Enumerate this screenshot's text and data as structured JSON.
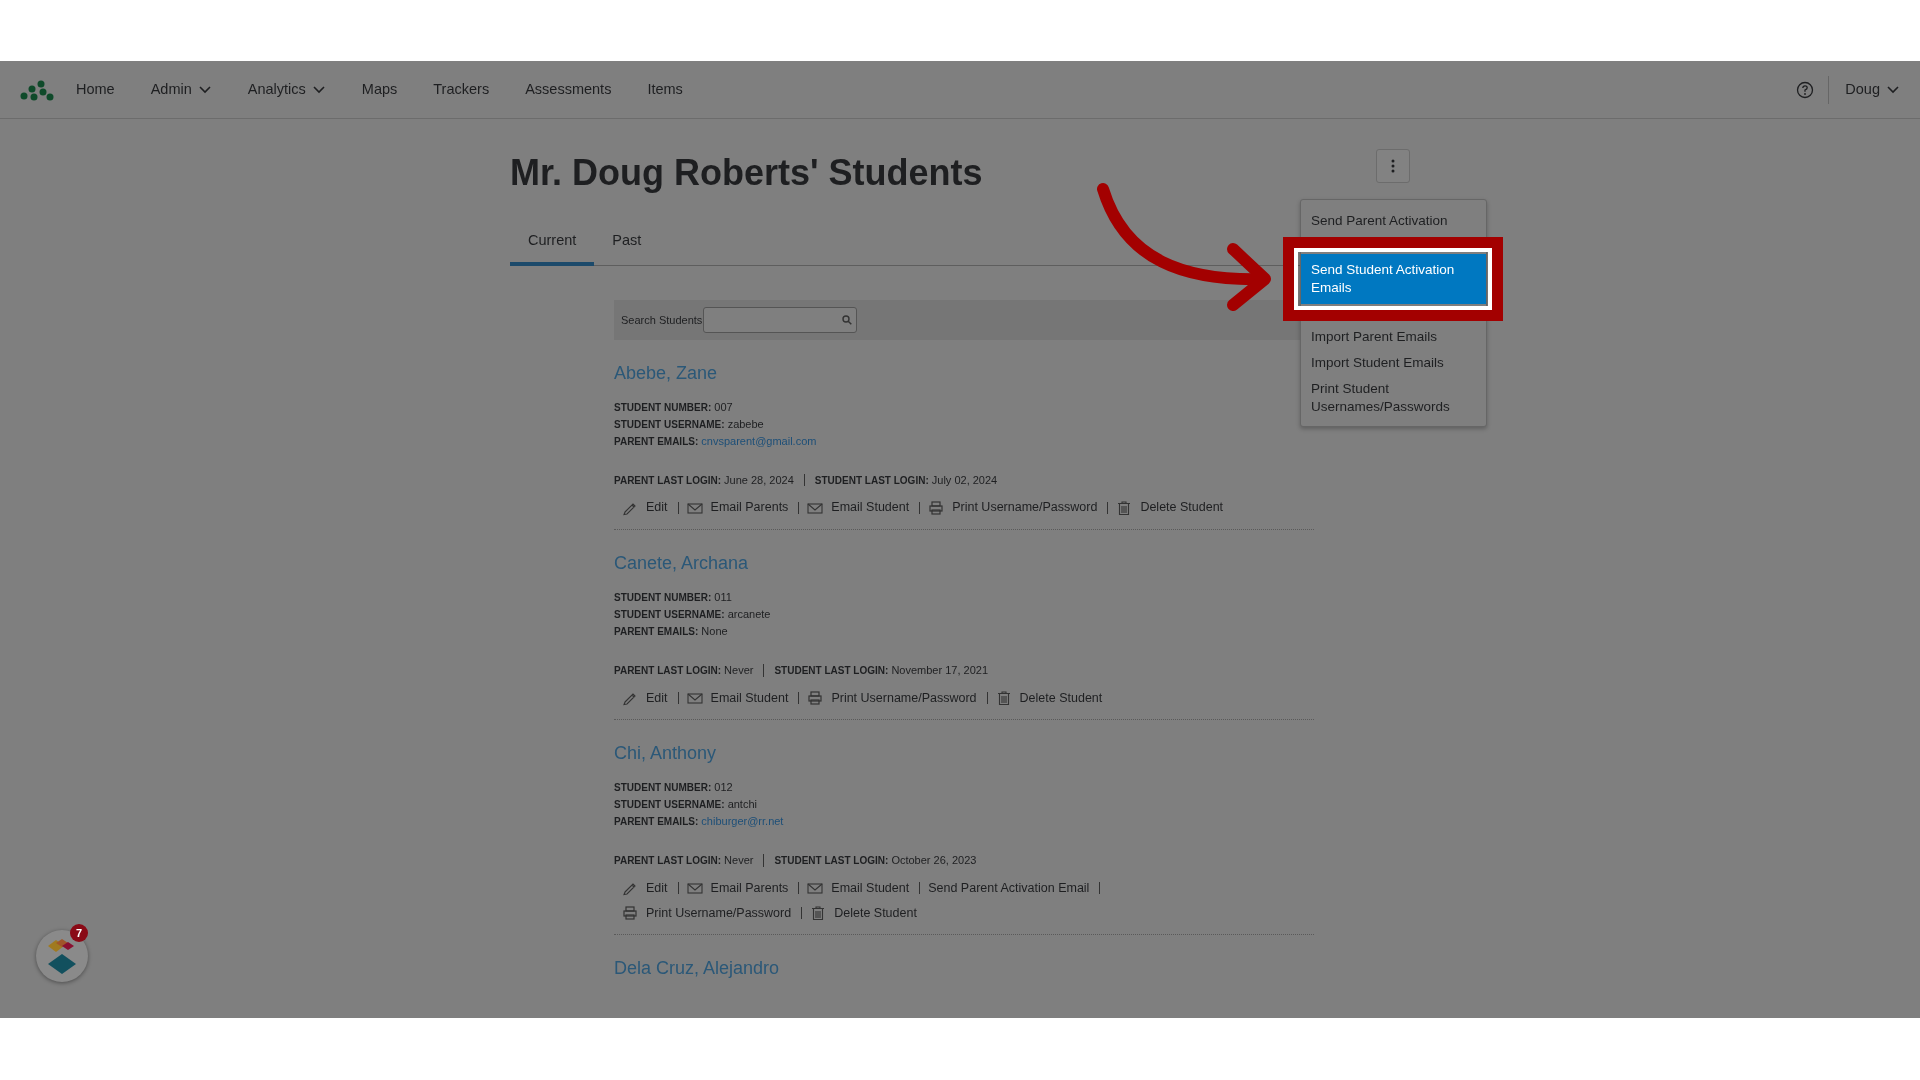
{
  "navbar": {
    "items": [
      {
        "label": "Home",
        "dropdown": false
      },
      {
        "label": "Admin",
        "dropdown": true
      },
      {
        "label": "Analytics",
        "dropdown": true
      },
      {
        "label": "Maps",
        "dropdown": false
      },
      {
        "label": "Trackers",
        "dropdown": false
      },
      {
        "label": "Assessments",
        "dropdown": false
      },
      {
        "label": "Items",
        "dropdown": false
      }
    ],
    "user": {
      "label": "Doug",
      "dropdown": true
    }
  },
  "page_title": "Mr. Doug Roberts' Students",
  "tabs": [
    {
      "label": "Current",
      "selected": true
    },
    {
      "label": "Past",
      "selected": false
    }
  ],
  "search": {
    "label": "Search Students"
  },
  "menu": {
    "items": [
      {
        "label": "Send Parent Activation",
        "selected": false
      },
      {
        "label": "Send Student Activation Emails",
        "selected": true
      },
      {
        "label": "Import Parent Emails",
        "selected": false
      },
      {
        "label": "Import Student Emails",
        "selected": false
      },
      {
        "label": "Print Student Usernames/Passwords",
        "selected": false
      }
    ]
  },
  "students": [
    {
      "name": "Abebe, Zane",
      "fields": [
        {
          "label": "STUDENT NUMBER:",
          "value": "007",
          "kind": "text"
        },
        {
          "label": "STUDENT USERNAME:",
          "value": "zabebe",
          "kind": "text"
        },
        {
          "label": "PARENT EMAILS:",
          "value": "cnvsparent@gmail.com",
          "kind": "link"
        }
      ],
      "logins": [
        {
          "label": "PARENT LAST LOGIN:",
          "value": "June 28, 2024"
        },
        {
          "label": "STUDENT LAST LOGIN:",
          "value": "July 02, 2024"
        }
      ],
      "actions": [
        {
          "label": "Edit",
          "kind": "edit"
        },
        {
          "label": "Email Parents",
          "kind": "mail"
        },
        {
          "label": "Email Student",
          "kind": "mail"
        },
        {
          "label": "Print Username/Password",
          "kind": "print"
        },
        {
          "label": "Delete Student",
          "kind": "delete"
        }
      ]
    },
    {
      "name": "Canete, Archana",
      "fields": [
        {
          "label": "STUDENT NUMBER:",
          "value": "011",
          "kind": "text"
        },
        {
          "label": "STUDENT USERNAME:",
          "value": "arcanete",
          "kind": "text"
        },
        {
          "label": "PARENT EMAILS:",
          "value": "None",
          "kind": "text"
        }
      ],
      "logins": [
        {
          "label": "PARENT LAST LOGIN:",
          "value": "Never"
        },
        {
          "label": "STUDENT LAST LOGIN:",
          "value": "November 17, 2021"
        }
      ],
      "actions": [
        {
          "label": "Edit",
          "kind": "edit"
        },
        {
          "label": "Email Student",
          "kind": "mail"
        },
        {
          "label": "Print Username/Password",
          "kind": "print"
        },
        {
          "label": "Delete Student",
          "kind": "delete"
        }
      ]
    },
    {
      "name": "Chi, Anthony",
      "fields": [
        {
          "label": "STUDENT NUMBER:",
          "value": "012",
          "kind": "text"
        },
        {
          "label": "STUDENT USERNAME:",
          "value": "antchi",
          "kind": "text"
        },
        {
          "label": "PARENT EMAILS:",
          "value": "chiburger@rr.net",
          "kind": "link"
        }
      ],
      "logins": [
        {
          "label": "PARENT LAST LOGIN:",
          "value": "Never"
        },
        {
          "label": "STUDENT LAST LOGIN:",
          "value": "October 26, 2023"
        }
      ],
      "actions": [
        {
          "label": "Edit",
          "kind": "edit"
        },
        {
          "label": "Email Parents",
          "kind": "mail"
        },
        {
          "label": "Email Student",
          "kind": "mail"
        },
        {
          "label": "Send Parent Activation Email",
          "kind": "plain"
        },
        {
          "label": "Print Username/Password",
          "kind": "print"
        },
        {
          "label": "Delete Student",
          "kind": "delete"
        }
      ]
    },
    {
      "name": "Dela Cruz, Alejandro"
    }
  ],
  "widget": {
    "count": "7"
  }
}
